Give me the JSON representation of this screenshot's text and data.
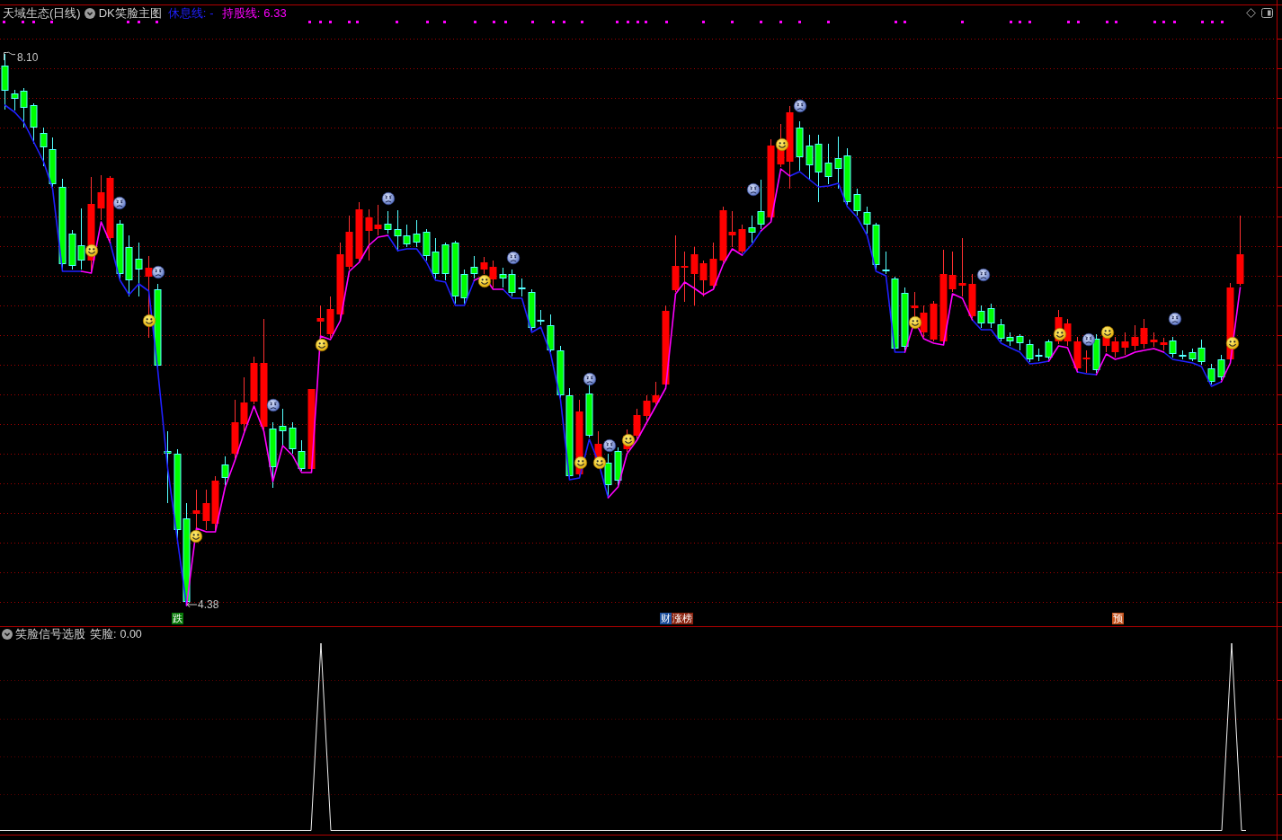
{
  "header": {
    "title": "天域生态(日线)",
    "indicator": "DK笑脸主图",
    "lines": [
      {
        "label": "休息线:",
        "value": "-",
        "color": "#2020ff"
      },
      {
        "label": "持股线:",
        "value": "6.33",
        "color": "#ff00ff"
      }
    ]
  },
  "price_chart": {
    "high_label": "8.10",
    "low_label": "4.38",
    "event_tags": [
      {
        "parts": [
          {
            "text": "跌",
            "color": "#0a7a0a"
          }
        ]
      },
      {
        "parts": [
          {
            "text": "财",
            "color": "#1d4f9c"
          },
          {
            "text": "涨榜",
            "color": "#8a2410"
          }
        ]
      },
      {
        "parts": [
          {
            "text": "预",
            "color": "#c4521c"
          }
        ]
      }
    ]
  },
  "indicator_panel": {
    "title": "笑脸信号选股",
    "readout_label": "笑脸:",
    "readout_value": "0.00"
  }
}
